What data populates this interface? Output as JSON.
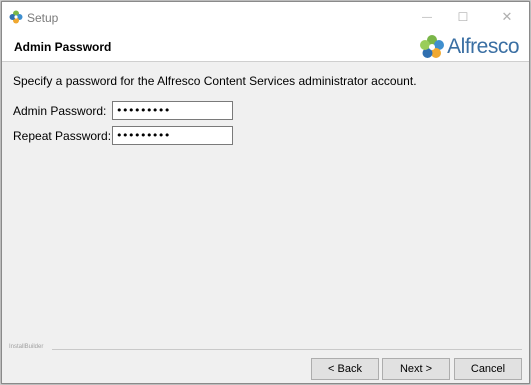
{
  "window": {
    "title": "Setup",
    "minimize_glyph": "—",
    "maximize_glyph": "☐",
    "close_glyph": "✕"
  },
  "header": {
    "page_title": "Admin Password",
    "logo_text": "Alfresco"
  },
  "main": {
    "instruction": "Specify a password for the Alfresco Content Services administrator account.",
    "fields": [
      {
        "label": "Admin Password:",
        "value": "•••••••••"
      },
      {
        "label": "Repeat Password:",
        "value": "•••••••••"
      }
    ]
  },
  "footer": {
    "brand": "InstallBuilder",
    "back_label": "< Back",
    "next_label": "Next >",
    "cancel_label": "Cancel"
  },
  "colors": {
    "logo_text": "#3a6fa3",
    "logo_petals": [
      "#7ab648",
      "#3f8fcf",
      "#f0a830",
      "#2f6fb0"
    ]
  },
  "icons": {
    "app": "alfresco-flower-icon",
    "logo": "alfresco-logo-icon"
  }
}
